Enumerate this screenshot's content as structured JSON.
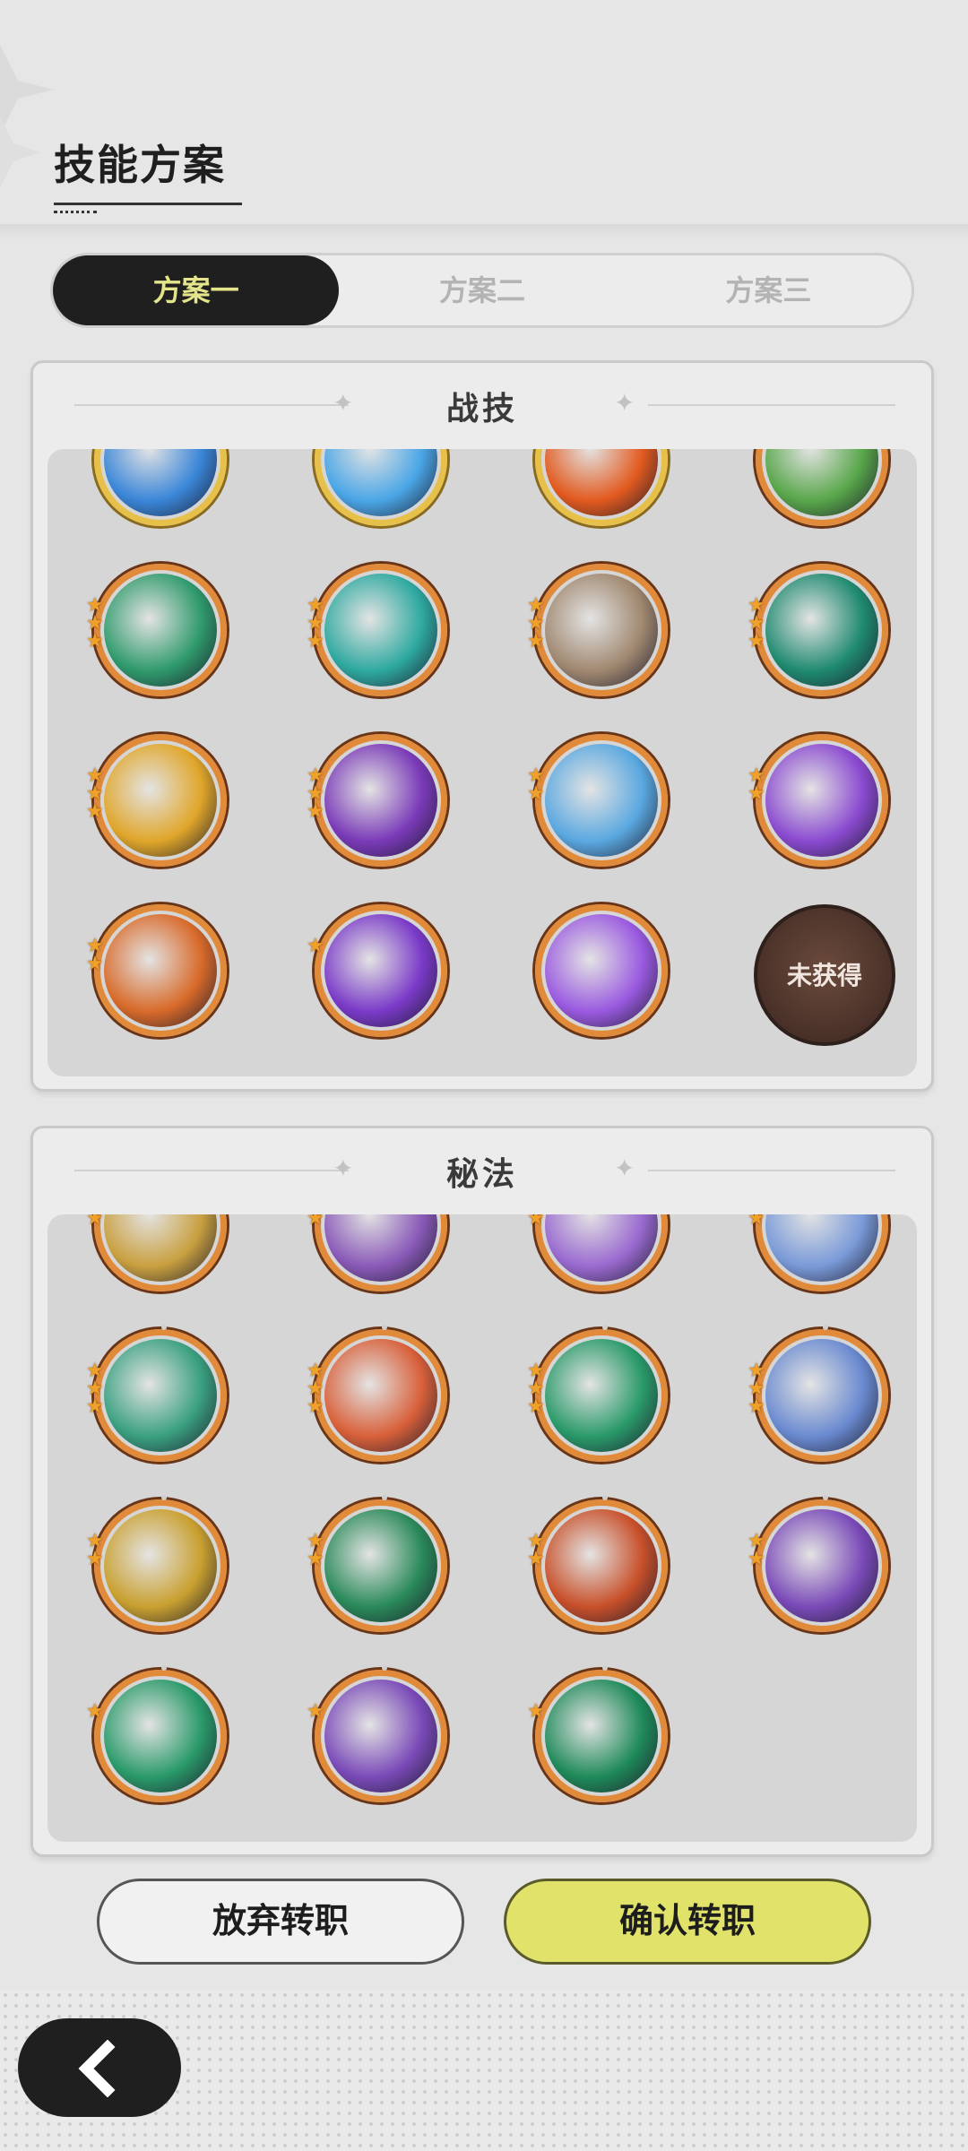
{
  "header": {
    "title": "技能方案"
  },
  "tabs": [
    {
      "label": "方案一",
      "active": true
    },
    {
      "label": "方案二",
      "active": false
    },
    {
      "label": "方案三",
      "active": false
    }
  ],
  "combat": {
    "label": "战技",
    "locked_label": "未获得",
    "rows": [
      [
        {
          "icon": "water-swirl-icon",
          "frame": "gold",
          "rank": 0,
          "color": "#3a86d8"
        },
        {
          "icon": "ice-shards-icon",
          "frame": "gold",
          "rank": 0,
          "color": "#4aa6e6"
        },
        {
          "icon": "fire-burst-icon",
          "frame": "gold",
          "rank": 0,
          "color": "#e25a1f"
        },
        {
          "icon": "tree-nature-icon",
          "frame": "orange",
          "rank": 1,
          "color": "#58a64a"
        }
      ],
      [
        {
          "icon": "green-wind-icon",
          "frame": "orange",
          "rank": 3,
          "color": "#2f9a6c"
        },
        {
          "icon": "cyclone-icon",
          "frame": "orange",
          "rank": 3,
          "color": "#2ea9a0"
        },
        {
          "icon": "rock-pillar-icon",
          "frame": "orange",
          "rank": 3,
          "color": "#a08870"
        },
        {
          "icon": "thorn-vines-icon",
          "frame": "orange",
          "rank": 3,
          "color": "#1f8a70"
        }
      ],
      [
        {
          "icon": "golden-sparkle-icon",
          "frame": "orange",
          "rank": 3,
          "color": "#e0a62a"
        },
        {
          "icon": "void-eye-icon",
          "frame": "orange",
          "rank": 3,
          "color": "#7a3ab8"
        },
        {
          "icon": "ice-burst-icon",
          "frame": "orange",
          "rank": 2,
          "color": "#5aa8e0"
        },
        {
          "icon": "purple-vortex-icon",
          "frame": "orange",
          "rank": 2,
          "color": "#8a4ad0"
        }
      ],
      [
        {
          "icon": "fire-wolf-icon",
          "frame": "orange",
          "rank": 2,
          "color": "#d86a2a"
        },
        {
          "icon": "arcane-hand-icon",
          "frame": "orange",
          "rank": 1,
          "color": "#7a3ac8"
        },
        {
          "icon": "star-explosion-icon",
          "frame": "orange",
          "rank": 0,
          "color": "#9a5ae0"
        },
        {
          "icon": "locked-icon",
          "frame": "locked",
          "rank": 0,
          "color": "#4a3028"
        }
      ]
    ]
  },
  "arcane": {
    "label": "秘法",
    "rows": [
      [
        {
          "icon": "golden-wing-icon",
          "frame": "orange",
          "rank": 2,
          "color": "#c9a040"
        },
        {
          "icon": "sigil-icon",
          "frame": "orange",
          "rank": 2,
          "color": "#8a5ab8"
        },
        {
          "icon": "spirit-mask-icon",
          "frame": "orange",
          "rank": 2,
          "color": "#9a6ad0"
        },
        {
          "icon": "frost-star-icon",
          "frame": "orange",
          "rank": 2,
          "color": "#7a9ad8"
        }
      ],
      [
        {
          "icon": "recycle-icon",
          "frame": "orange",
          "rank": 3,
          "color": "#3aa080"
        },
        {
          "icon": "flame-figure-icon",
          "frame": "orange",
          "rank": 3,
          "color": "#d8603a"
        },
        {
          "icon": "green-figure-icon",
          "frame": "orange",
          "rank": 3,
          "color": "#2a9a6a"
        },
        {
          "icon": "sparkle-star-icon",
          "frame": "orange",
          "rank": 3,
          "color": "#6a8ad0"
        }
      ],
      [
        {
          "icon": "golden-arrow-icon",
          "frame": "orange",
          "rank": 2,
          "color": "#c9a030"
        },
        {
          "icon": "green-clock-icon",
          "frame": "orange",
          "rank": 2,
          "color": "#2a8a5a"
        },
        {
          "icon": "red-fist-icon",
          "frame": "orange",
          "rank": 2,
          "color": "#c8502a"
        },
        {
          "icon": "purple-figure-icon",
          "frame": "orange",
          "rank": 2,
          "color": "#7a4ab8"
        }
      ],
      [
        {
          "icon": "green-shield-icon",
          "frame": "orange",
          "rank": 1,
          "color": "#2a9a6a"
        },
        {
          "icon": "purple-spirit-icon",
          "frame": "orange",
          "rank": 1,
          "color": "#7a4ab8"
        },
        {
          "icon": "green-sparkle-icon",
          "frame": "orange",
          "rank": 1,
          "color": "#1f8a5a"
        }
      ]
    ]
  },
  "buttons": {
    "abandon": "放弃转职",
    "confirm": "确认转职"
  },
  "back_icon": "back-arrow-icon"
}
